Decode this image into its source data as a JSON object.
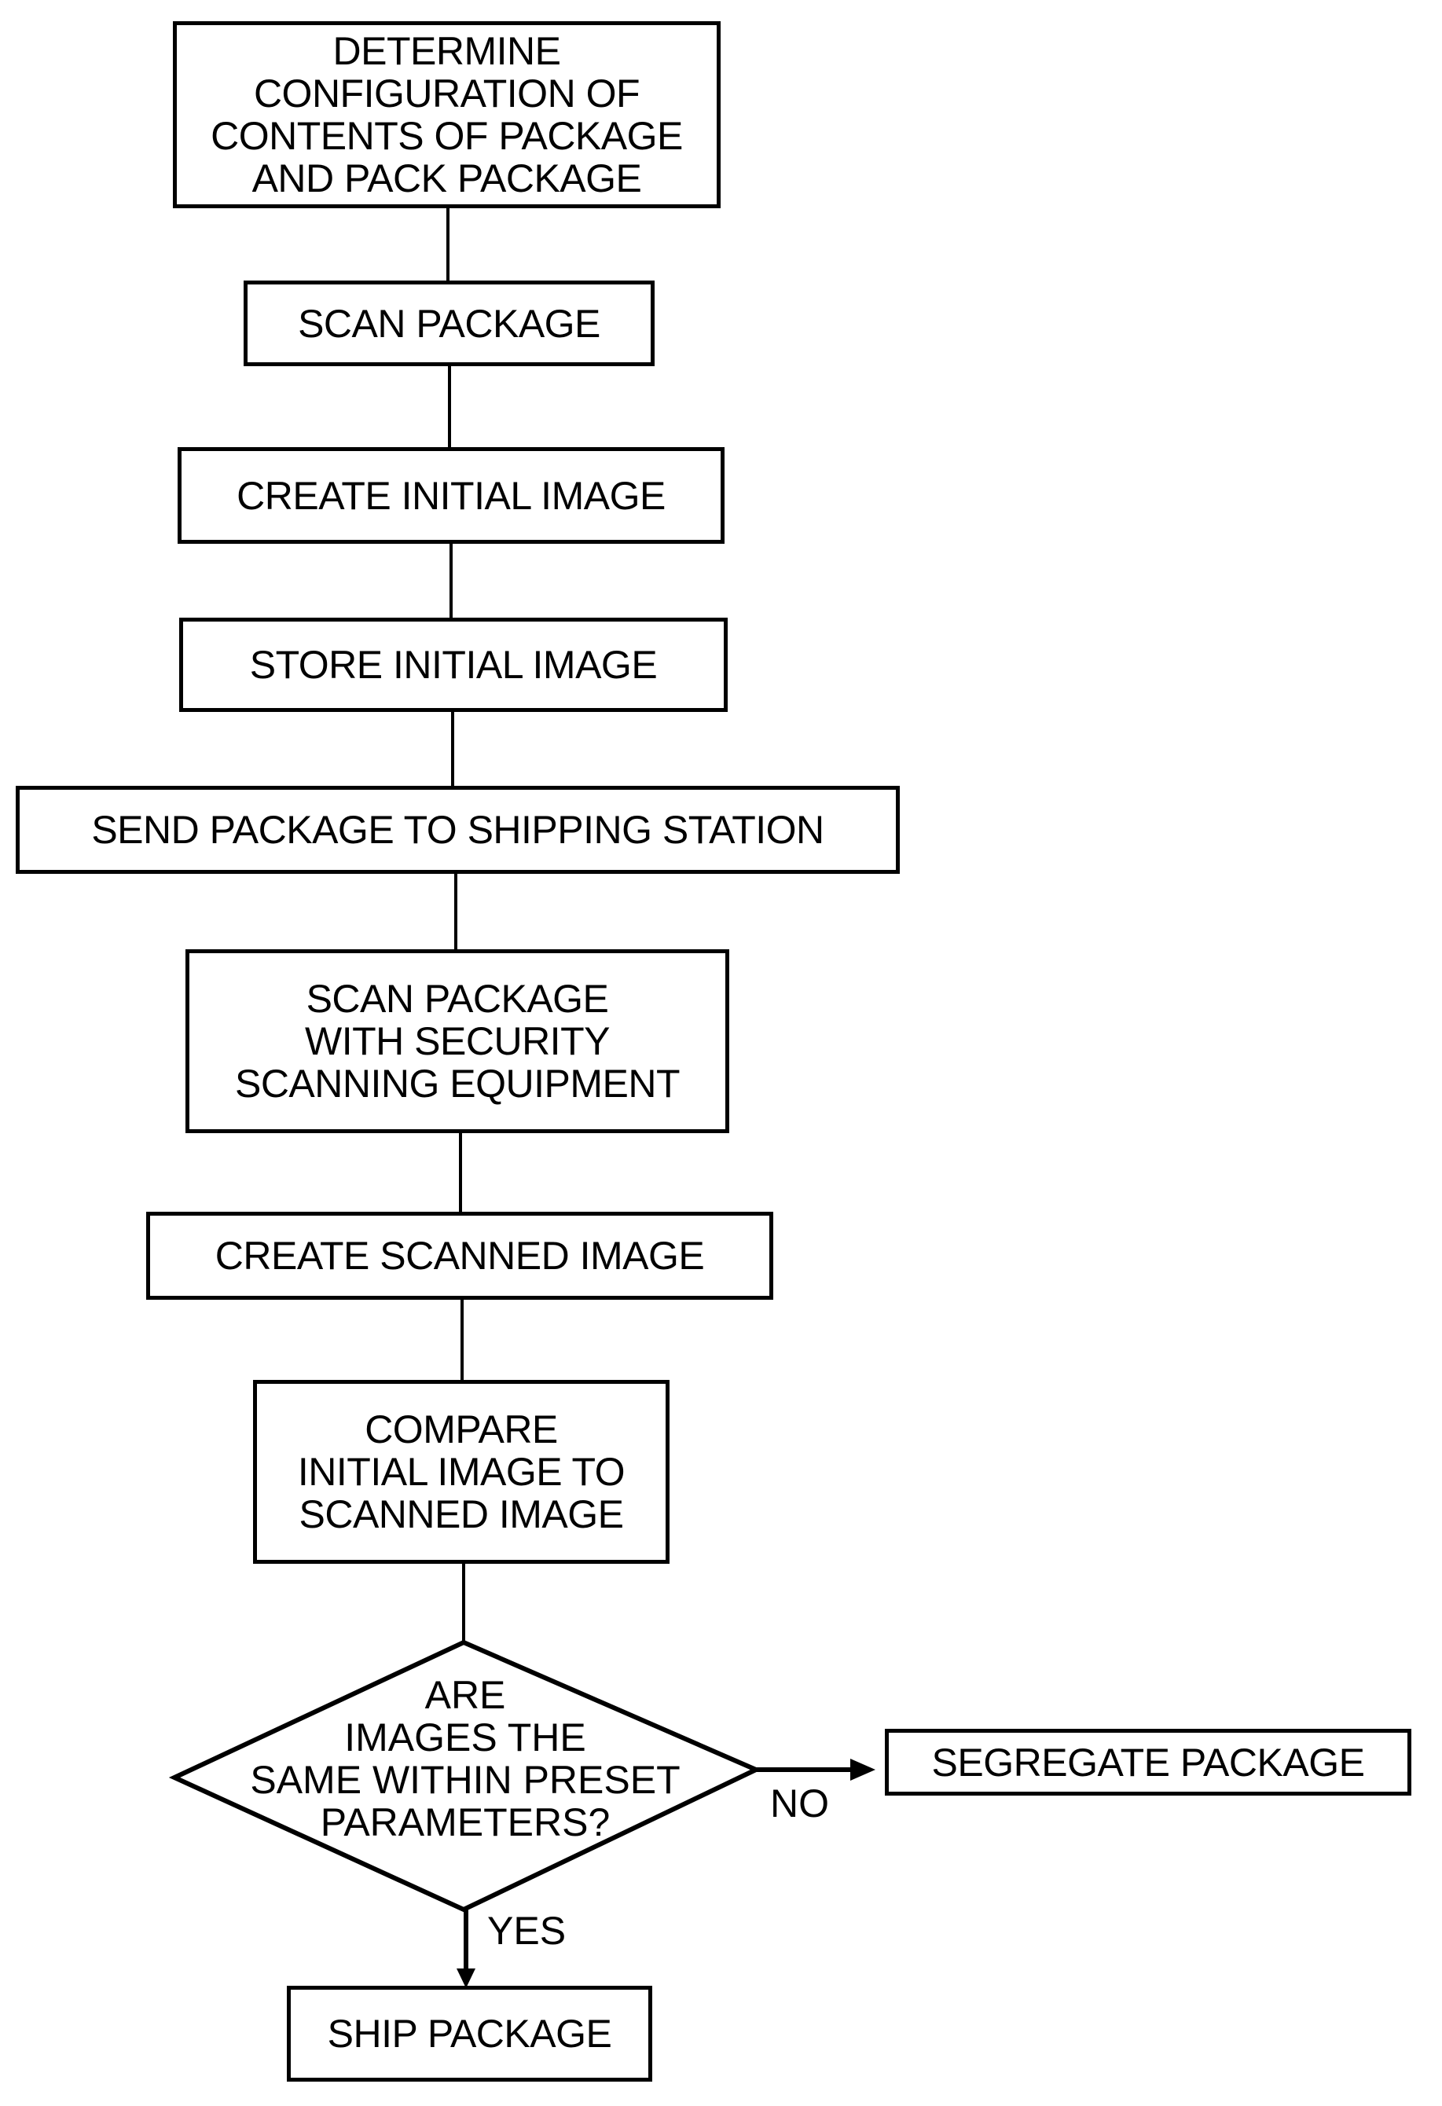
{
  "diagram": {
    "type": "flowchart",
    "steps": [
      {
        "id": "determine-configuration",
        "text": "DETERMINE\nCONFIGURATION OF\nCONTENTS OF PACKAGE\nAND PACK PACKAGE"
      },
      {
        "id": "scan-package",
        "text": "SCAN PACKAGE"
      },
      {
        "id": "create-initial-image",
        "text": "CREATE INITIAL IMAGE"
      },
      {
        "id": "store-initial-image",
        "text": "STORE INITIAL IMAGE"
      },
      {
        "id": "send-to-shipping-station",
        "text": "SEND PACKAGE TO SHIPPING STATION"
      },
      {
        "id": "security-scan",
        "text": "SCAN PACKAGE\nWITH SECURITY\nSCANNING EQUIPMENT"
      },
      {
        "id": "create-scanned-image",
        "text": "CREATE SCANNED IMAGE"
      },
      {
        "id": "compare-images",
        "text": "COMPARE\nINITIAL IMAGE TO\nSCANNED IMAGE"
      }
    ],
    "decision": {
      "id": "images-same",
      "text": "ARE\nIMAGES THE\nSAME WITHIN PRESET\nPARAMETERS?"
    },
    "branches": {
      "no": {
        "label": "NO",
        "target": "SEGREGATE PACKAGE"
      },
      "yes": {
        "label": "YES",
        "target": "SHIP PACKAGE"
      }
    }
  }
}
